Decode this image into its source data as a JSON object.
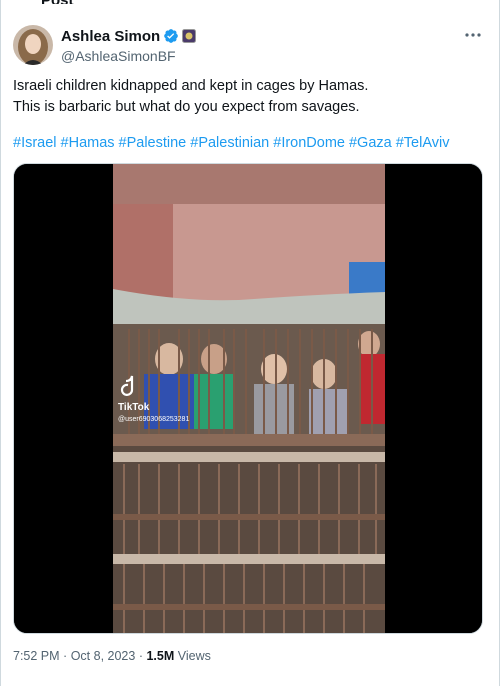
{
  "tweet": {
    "author": {
      "display_name": "Ashlea Simon",
      "handle": "@AshleaSimonBF",
      "verified": true
    },
    "more_icon": "more-icon",
    "text_lines": [
      "Israeli children kidnapped and kept in cages by Hamas.",
      "This is barbaric but what do you expect from savages."
    ],
    "hashtags": [
      "#Israel",
      "#Hamas",
      "#Palestine",
      "#Palestinian",
      "#IronDome",
      "#Gaza",
      "#TelAviv"
    ],
    "media": {
      "watermark_brand": "TikTok",
      "watermark_user": "@user6903068253281"
    },
    "meta": {
      "time": "7:52 PM",
      "separator": "·",
      "date": "Oct 8, 2023",
      "views_count": "1.5M",
      "views_label": "Views"
    }
  },
  "colors": {
    "link": "#1d9bf0",
    "secondary_text": "#536471",
    "verified_badge": "#1d9bf0"
  }
}
